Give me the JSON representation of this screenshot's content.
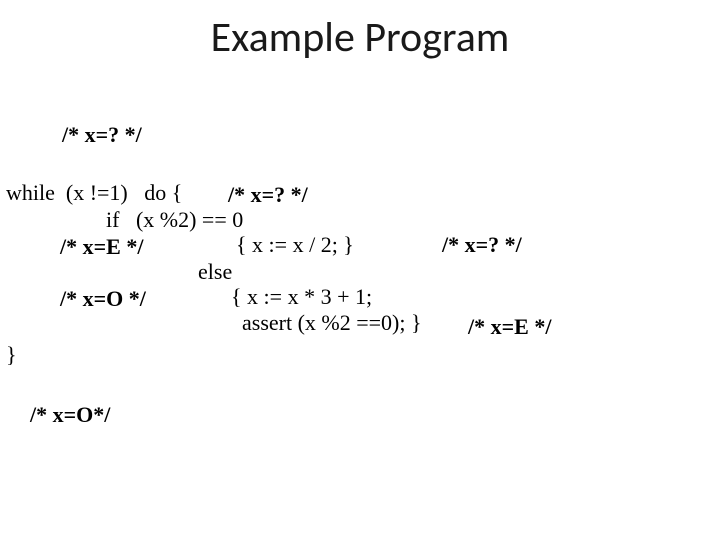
{
  "title": "Example Program",
  "c_pre": "/* x=? */",
  "while_head": "while  (x !=1)   do {",
  "c_loop": "/* x=? */",
  "if_head": "if   (x %2) == 0",
  "c_even": "/* x=E */",
  "then_body": "{ x := x / 2; }",
  "c_then": "/* x=? */",
  "else_kw": "else",
  "c_odd": "/* x=O */",
  "else_body1": "{ x := x * 3 + 1;",
  "else_body2": "  assert (x %2 ==0); }",
  "c_after_else": "/* x=E */",
  "closebrace": "}",
  "c_post": "/* x=O*/"
}
